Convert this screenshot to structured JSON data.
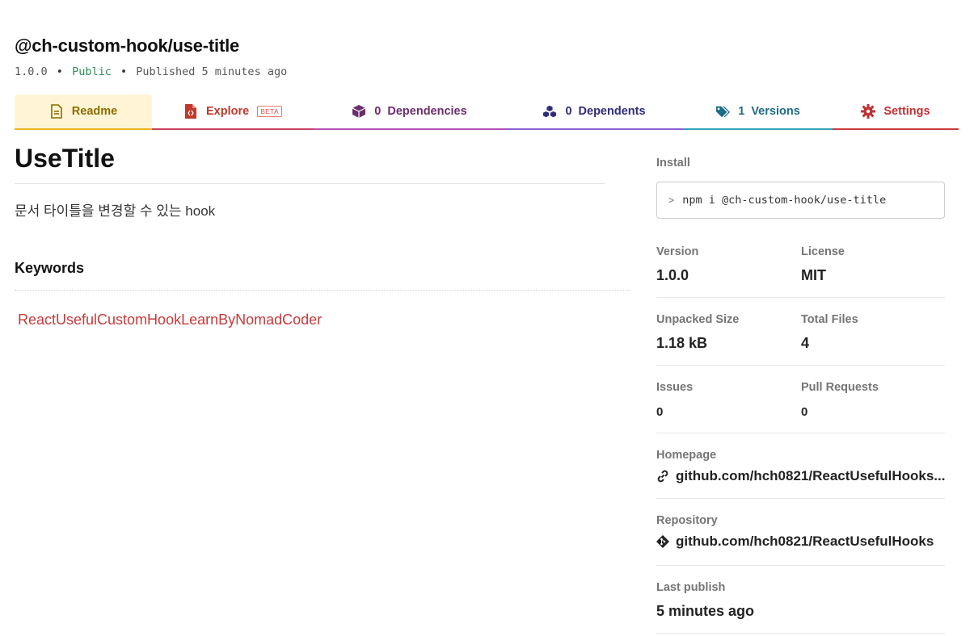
{
  "package": {
    "name": "@ch-custom-hook/use-title",
    "version": "1.0.0",
    "visibility": "Public",
    "published": "Published 5 minutes ago"
  },
  "tabs": {
    "readme": {
      "label": "Readme"
    },
    "explore": {
      "label": "Explore",
      "badge": "BETA"
    },
    "dependencies": {
      "count": "0",
      "label": "Dependencies"
    },
    "dependents": {
      "count": "0",
      "label": "Dependents"
    },
    "versions": {
      "count": "1",
      "label": "Versions"
    },
    "settings": {
      "label": "Settings"
    }
  },
  "readme": {
    "title": "UseTitle",
    "description": "문서 타이틀을 변경할 수 있는 hook",
    "keywords_heading": "Keywords",
    "keywords": [
      "ReactUsefulCustomHookLearnByNomadCoder"
    ]
  },
  "sidebar": {
    "install_label": "Install",
    "install_command": "npm i @ch-custom-hook/use-title",
    "version_label": "Version",
    "version_value": "1.0.0",
    "license_label": "License",
    "license_value": "MIT",
    "unpacked_size_label": "Unpacked Size",
    "unpacked_size_value": "1.18 kB",
    "total_files_label": "Total Files",
    "total_files_value": "4",
    "issues_label": "Issues",
    "issues_value": "0",
    "pull_requests_label": "Pull Requests",
    "pull_requests_value": "0",
    "homepage_label": "Homepage",
    "homepage_value": "github.com/hch0821/ReactUsefulHooks...",
    "repository_label": "Repository",
    "repository_value": "github.com/hch0821/ReactUsefulHooks",
    "last_publish_label": "Last publish",
    "last_publish_value": "5 minutes ago"
  },
  "colors": {
    "public": "#2e8b57",
    "keyword": "#c73a3a",
    "readme_tab_bg": "#fff5d6"
  }
}
